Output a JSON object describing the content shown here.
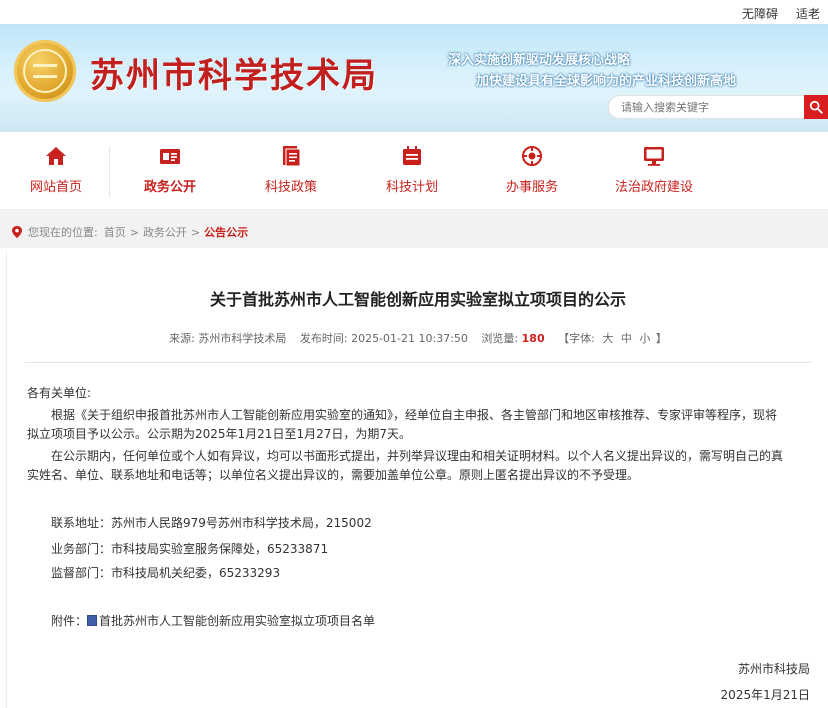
{
  "topbar": {
    "accessibility": "无障碍",
    "elder": "适老版"
  },
  "header": {
    "site_title": "苏州市科学技术局",
    "slogan1": "深入实施创新驱动发展核心战略",
    "slogan2": "加快建设具有全球影响力的产业科技创新高地",
    "search_placeholder": "请输入搜索关键字"
  },
  "nav": {
    "items": [
      {
        "label": "网站首页",
        "icon": "home-icon"
      },
      {
        "label": "政务公开",
        "icon": "gov-open-icon"
      },
      {
        "label": "科技政策",
        "icon": "policy-doc-icon"
      },
      {
        "label": "科技计划",
        "icon": "plan-calendar-icon"
      },
      {
        "label": "办事服务",
        "icon": "service-icon"
      },
      {
        "label": "法治政府建设",
        "icon": "monitor-icon"
      }
    ],
    "active_index": 1
  },
  "breadcrumb": {
    "prefix": "您现在的位置:",
    "home": "首页",
    "level1": "政务公开",
    "current": "公告公示",
    "sep": ">"
  },
  "article": {
    "title": "关于首批苏州市人工智能创新应用实验室拟立项项目的公示",
    "meta": {
      "source_label": "来源:",
      "source": "苏州市科学技术局",
      "time_label": "发布时间:",
      "time": "2025-01-21 10:37:50",
      "views_label": "浏览量:",
      "views": "180",
      "font_label": "【字体:",
      "font_big": "大",
      "font_mid": "中",
      "font_small": "小",
      "font_end": "】"
    },
    "salutation": "各有关单位:",
    "para1_line1": "根据《关于组织申报首批苏州市人工智能创新应用实验室的通知》，经单位自主申报、各主管部门和地区审核推荐、专家评审等程序，现将",
    "para1_line2": "拟立项项目予以公示。公示期为2025年1月21日至1月27日，为期7天。",
    "para2_line1": "在公示期内，任何单位或个人如有异议，均可以书面形式提出，并列举异议理由和相关证明材料。以个人名义提出异议的，需写明自己的真",
    "para2_line2": "实姓名、单位、联系地址和电话等；以单位名义提出异议的，需要加盖单位公章。原则上匿名提出异议的不予受理。",
    "contact_address": "联系地址：苏州市人民路979号苏州市科学技术局，215002",
    "contact_dept": "业务部门：市科技局实验室服务保障处，65233871",
    "contact_supervise": "监督部门：市科技局机关纪委，65233293",
    "attachment_label": "附件：",
    "attachment_link": "首批苏州市人工智能创新应用实验室拟立项项目名单",
    "sign_org": "苏州市科技局",
    "sign_date": "2025年1月21日"
  },
  "colors": {
    "brand_red": "#c8201c",
    "header_sky": "#bfe6f8"
  }
}
